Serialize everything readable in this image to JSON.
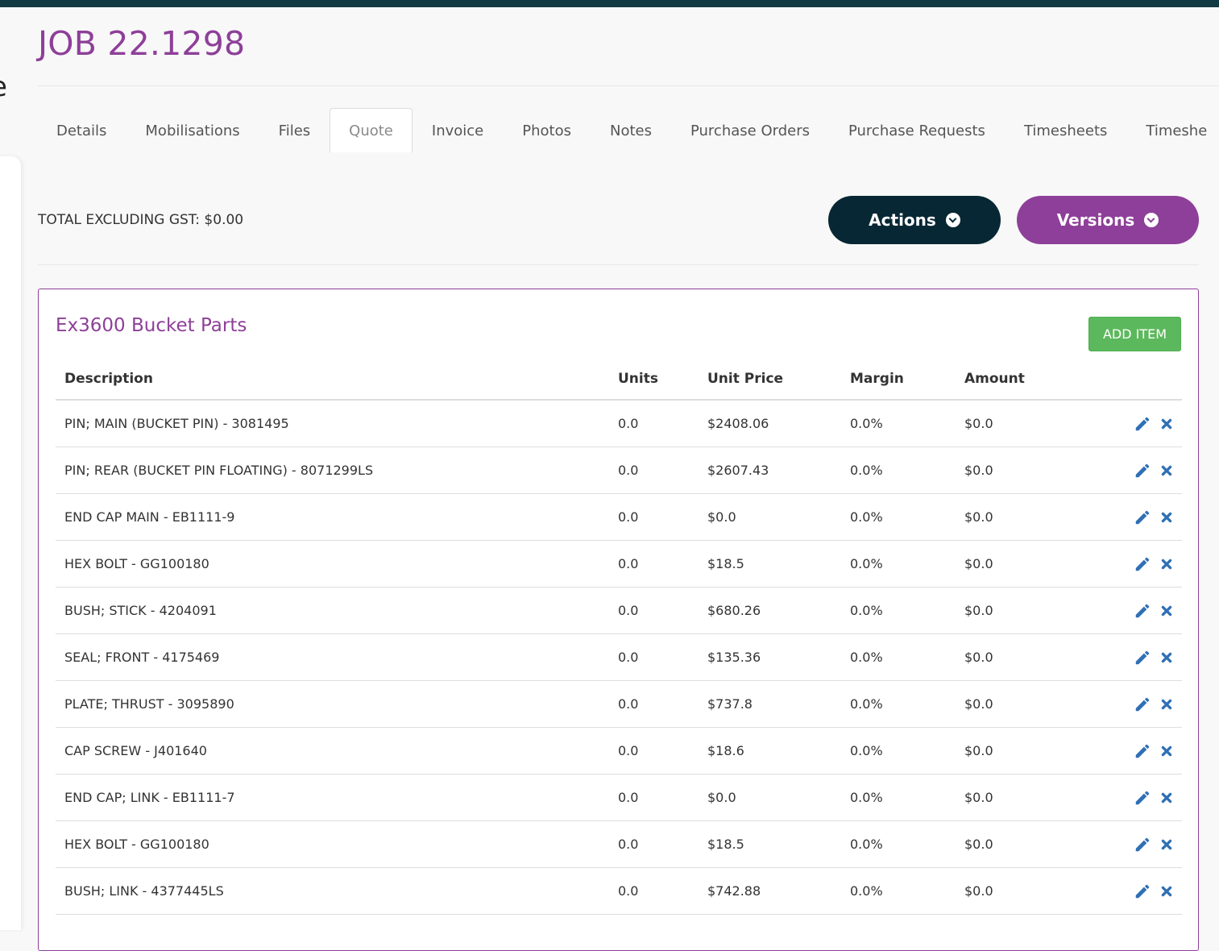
{
  "header": {
    "job_title": "JOB 22.1298"
  },
  "sidebar": {
    "partial_glyph": "e"
  },
  "tabs": [
    {
      "label": "Details"
    },
    {
      "label": "Mobilisations"
    },
    {
      "label": "Files"
    },
    {
      "label": "Quote",
      "active": true
    },
    {
      "label": "Invoice"
    },
    {
      "label": "Photos"
    },
    {
      "label": "Notes"
    },
    {
      "label": "Purchase Orders"
    },
    {
      "label": "Purchase Requests"
    },
    {
      "label": "Timesheets"
    },
    {
      "label": "Timeshe"
    }
  ],
  "quote": {
    "total_text": "TOTAL EXCLUDING GST: $0.00",
    "actions_label": "Actions",
    "versions_label": "Versions"
  },
  "section": {
    "title": "Ex3600 Bucket Parts",
    "add_item_label": "ADD ITEM",
    "columns": [
      "Description",
      "Units",
      "Unit Price",
      "Margin",
      "Amount"
    ],
    "rows": [
      {
        "description": "PIN; MAIN (BUCKET PIN) - 3081495",
        "units": "0.0",
        "unit_price": "$2408.06",
        "margin": "0.0%",
        "amount": "$0.0"
      },
      {
        "description": "PIN; REAR (BUCKET PIN FLOATING) - 8071299LS",
        "units": "0.0",
        "unit_price": "$2607.43",
        "margin": "0.0%",
        "amount": "$0.0"
      },
      {
        "description": "END CAP MAIN - EB1111-9",
        "units": "0.0",
        "unit_price": "$0.0",
        "margin": "0.0%",
        "amount": "$0.0"
      },
      {
        "description": "HEX BOLT - GG100180",
        "units": "0.0",
        "unit_price": "$18.5",
        "margin": "0.0%",
        "amount": "$0.0"
      },
      {
        "description": "BUSH; STICK - 4204091",
        "units": "0.0",
        "unit_price": "$680.26",
        "margin": "0.0%",
        "amount": "$0.0"
      },
      {
        "description": "SEAL; FRONT - 4175469",
        "units": "0.0",
        "unit_price": "$135.36",
        "margin": "0.0%",
        "amount": "$0.0"
      },
      {
        "description": "PLATE; THRUST - 3095890",
        "units": "0.0",
        "unit_price": "$737.8",
        "margin": "0.0%",
        "amount": "$0.0"
      },
      {
        "description": "CAP SCREW - J401640",
        "units": "0.0",
        "unit_price": "$18.6",
        "margin": "0.0%",
        "amount": "$0.0"
      },
      {
        "description": "END CAP; LINK - EB1111-7",
        "units": "0.0",
        "unit_price": "$0.0",
        "margin": "0.0%",
        "amount": "$0.0"
      },
      {
        "description": "HEX BOLT - GG100180",
        "units": "0.0",
        "unit_price": "$18.5",
        "margin": "0.0%",
        "amount": "$0.0"
      },
      {
        "description": "BUSH; LINK - 4377445LS",
        "units": "0.0",
        "unit_price": "$742.88",
        "margin": "0.0%",
        "amount": "$0.0"
      }
    ]
  },
  "icons": {
    "edit": "pencil-icon",
    "delete": "close-icon",
    "dropdown": "chevron-down-icon"
  },
  "colors": {
    "brand_purple": "#8e3f99",
    "dark_navy": "#062733",
    "success_green": "#5cb85c",
    "icon_blue": "#2f6fb5"
  }
}
